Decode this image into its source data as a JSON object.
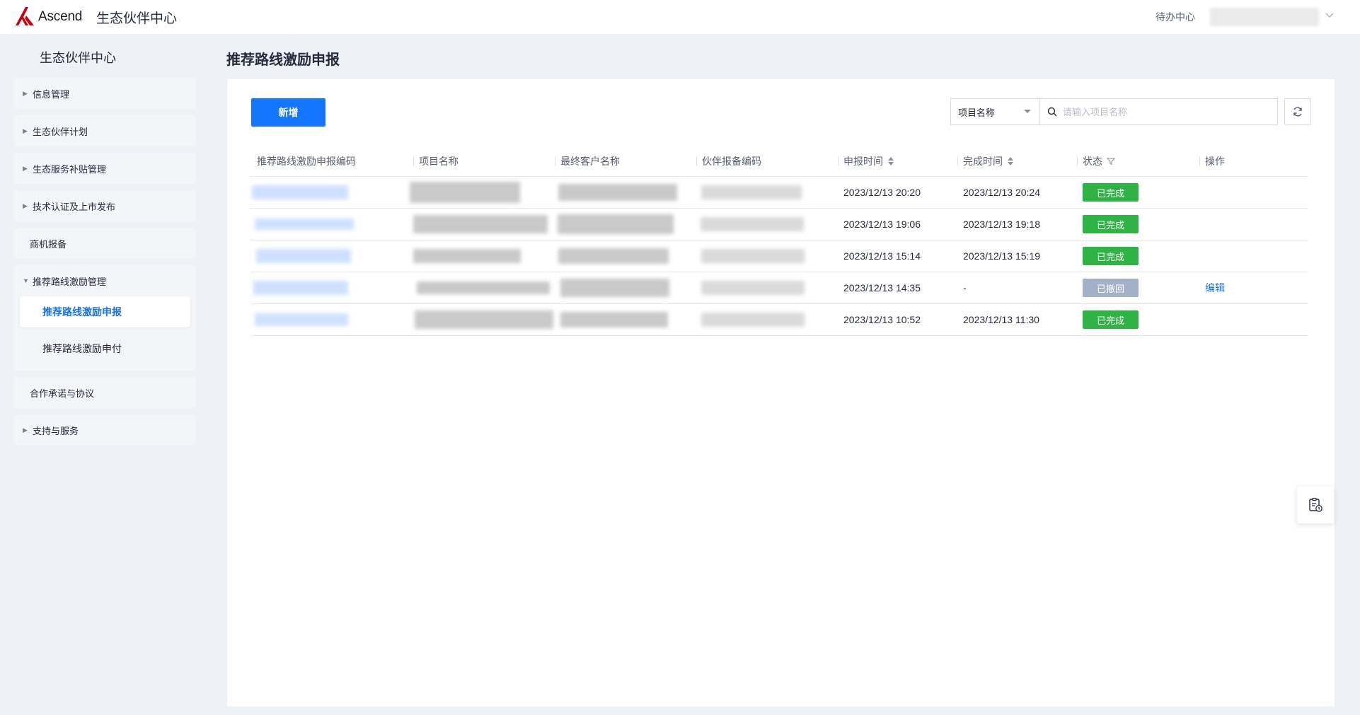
{
  "header": {
    "brand": "Ascend",
    "app_title": "生态伙伴中心",
    "todo_label": "待办中心",
    "brand_color": "#c7000b"
  },
  "sidebar": {
    "title": "生态伙伴中心",
    "items": [
      {
        "label": "信息管理",
        "expandable": true
      },
      {
        "label": "生态伙伴计划",
        "expandable": true
      },
      {
        "label": "生态服务补贴管理",
        "expandable": true
      },
      {
        "label": "技术认证及上市发布",
        "expandable": true
      },
      {
        "label": "商机报备",
        "expandable": false
      },
      {
        "label": "推荐路线激励管理",
        "expandable": true,
        "expanded": true,
        "children": [
          {
            "label": "推荐路线激励申报",
            "active": true
          },
          {
            "label": "推荐路线激励申付",
            "active": false
          }
        ]
      },
      {
        "label": "合作承诺与协议",
        "expandable": false
      },
      {
        "label": "支持与服务",
        "expandable": true
      }
    ]
  },
  "main": {
    "page_title": "推荐路线激励申报",
    "new_button": "新增",
    "filter": {
      "selected": "项目名称"
    },
    "search": {
      "placeholder": "请输入项目名称",
      "value": ""
    },
    "table": {
      "columns": [
        "推荐路线激励申报编码",
        "项目名称",
        "最终客户名称",
        "伙伴报备编码",
        "申报时间",
        "完成时间",
        "状态",
        "操作"
      ],
      "rows": [
        {
          "submit_time": "2023/12/13 20:20",
          "complete_time": "2023/12/13 20:24",
          "status": "已完成",
          "status_type": "done",
          "action": ""
        },
        {
          "submit_time": "2023/12/13 19:06",
          "complete_time": "2023/12/13 19:18",
          "status": "已完成",
          "status_type": "done",
          "action": ""
        },
        {
          "submit_time": "2023/12/13 15:14",
          "complete_time": "2023/12/13 15:19",
          "status": "已完成",
          "status_type": "done",
          "action": ""
        },
        {
          "submit_time": "2023/12/13 14:35",
          "complete_time": "-",
          "status": "已撤回",
          "status_type": "revoked",
          "action": "编辑"
        },
        {
          "submit_time": "2023/12/13 10:52",
          "complete_time": "2023/12/13 11:30",
          "status": "已完成",
          "status_type": "done",
          "action": ""
        }
      ]
    }
  },
  "colors": {
    "primary": "#1476ff",
    "success": "#2fb344",
    "revoked": "#a4b0c8",
    "link": "#1a72e6",
    "page_bg": "#eef1f6"
  }
}
